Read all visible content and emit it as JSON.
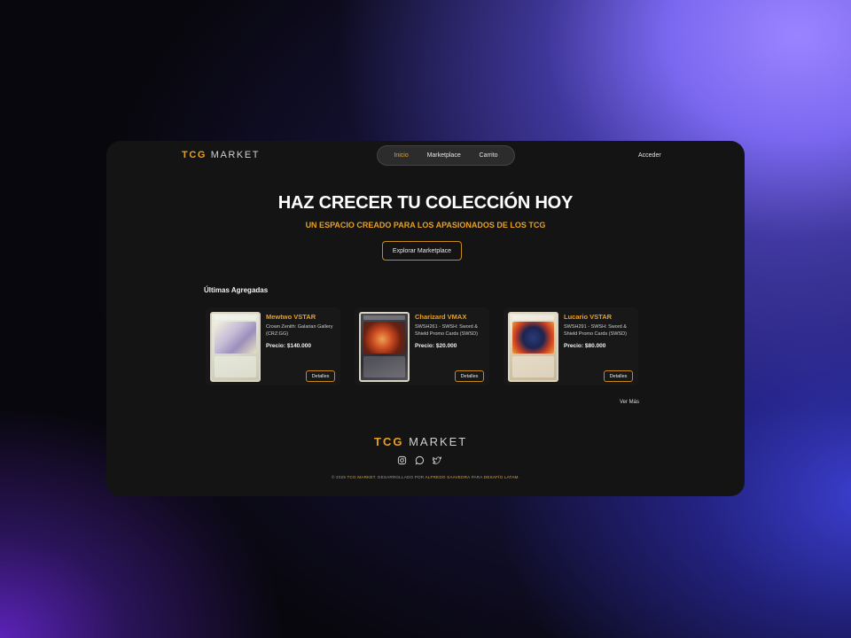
{
  "header": {
    "logo_primary": "TCG",
    "logo_secondary": "MARKET",
    "nav": [
      "Inicio",
      "Marketplace",
      "Carrito"
    ],
    "active_nav": "Inicio",
    "login_label": "Acceder"
  },
  "hero": {
    "title": "HAZ CRECER TU COLECCIÓN HOY",
    "subtitle": "UN ESPACIO CREADO PARA LOS APASIONADOS DE LOS TCG",
    "cta_label": "Explorar Marketplace"
  },
  "latest": {
    "title": "Últimas Agregadas",
    "see_more_label": "Ver Más",
    "cards": [
      {
        "name": "Mewtwo VSTAR",
        "set": "Crown Zenith: Galarian Gallery (CRZ:GG)",
        "price": "Precio: $140.000",
        "details_label": "Detalles"
      },
      {
        "name": "Charizard VMAX",
        "set": "SWSH261 - SWSH: Sword & Shield Promo Cards (SWSD)",
        "price": "Precio: $20.000",
        "details_label": "Detalles"
      },
      {
        "name": "Lucario VSTAR",
        "set": "SWSH291 - SWSH: Sword & Shield Promo Cards (SWSD)",
        "price": "Precio: $80.000",
        "details_label": "Detalles"
      }
    ]
  },
  "footer": {
    "logo_primary": "TCG",
    "logo_secondary": "MARKET",
    "copyright_prefix": "© 2025",
    "copyright_brand": "TCG MARKET",
    "copyright_mid": ". DESARROLLADO POR",
    "copyright_author": "ALFREDO SAAVEDRA",
    "copyright_para": "PARA",
    "copyright_org": "DESAFÍO LATAM",
    "copyright_end": ".",
    "social_icons": [
      "instagram-icon",
      "whatsapp-icon",
      "twitter-icon"
    ]
  },
  "colors": {
    "accent": "#e8a020",
    "panel": "#141414",
    "text": "#ffffff"
  }
}
